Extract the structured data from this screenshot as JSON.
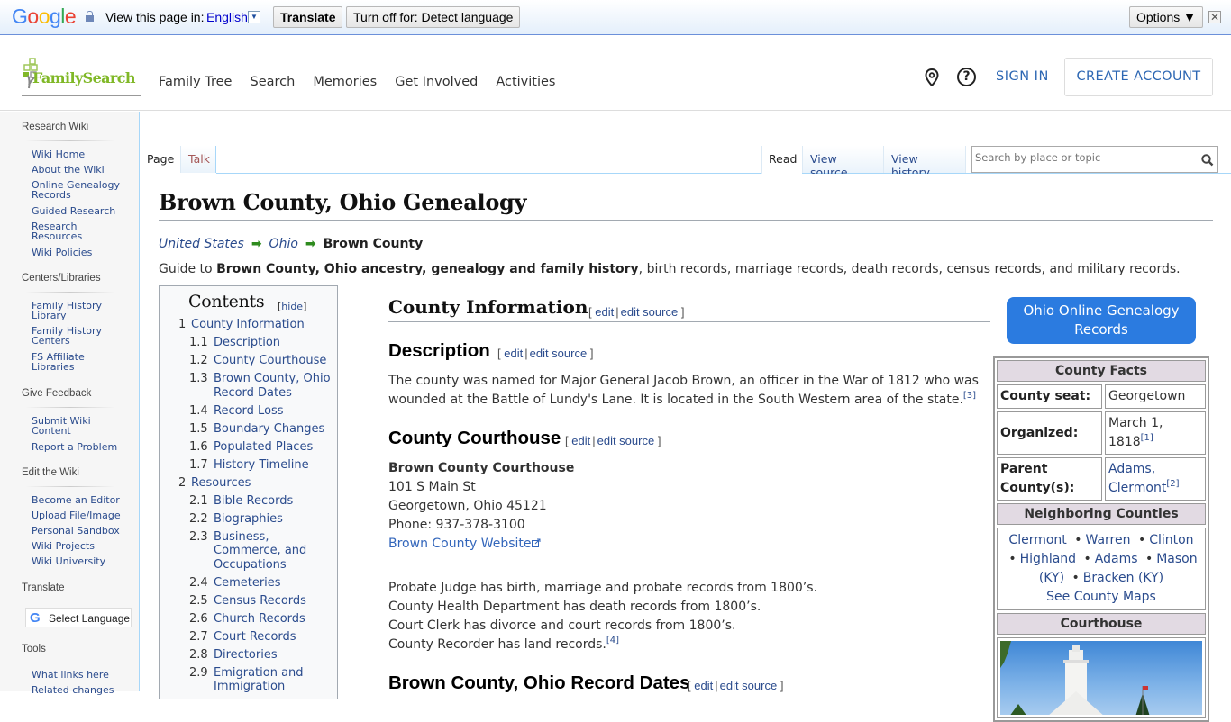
{
  "translate_bar": {
    "logo_letters": [
      "G",
      "o",
      "o",
      "g",
      "l",
      "e"
    ],
    "prompt": "View this page in:",
    "language": "English",
    "language_arrow": "▼",
    "translate_button": "Translate",
    "turn_off_button": "Turn off for: Detect language",
    "options_button": "Options ▼",
    "close_glyph": "✕"
  },
  "header": {
    "logo_text": "FamilySearch",
    "nav": [
      "Family Tree",
      "Search",
      "Memories",
      "Get Involved",
      "Activities"
    ],
    "help_glyph": "?",
    "sign_in": "SIGN IN",
    "create_account": "CREATE ACCOUNT"
  },
  "sidebar": {
    "sections": [
      {
        "title": "Research Wiki",
        "items": [
          "Wiki Home",
          "About the Wiki",
          "Online Genealogy Records",
          "Guided Research",
          "Research Resources",
          "Wiki Policies"
        ]
      },
      {
        "title": "Centers/Libraries",
        "items": [
          "Family History Library",
          "Family History Centers",
          "FS Affiliate Libraries"
        ]
      },
      {
        "title": "Give Feedback",
        "items": [
          "Submit Wiki Content",
          "Report a Problem"
        ]
      },
      {
        "title": "Edit the Wiki",
        "items": [
          "Become an Editor",
          "Upload File/Image",
          "Personal Sandbox",
          "Wiki Projects",
          "Wiki University"
        ]
      },
      {
        "title": "Translate",
        "items": []
      },
      {
        "title": "Tools",
        "items": [
          "What links here",
          "Related changes"
        ]
      }
    ],
    "select_language": "Select Language"
  },
  "tabs": {
    "page": "Page",
    "talk": "Talk",
    "read": "Read",
    "view_source": "View source",
    "view_history": "View history"
  },
  "search": {
    "placeholder": "Search by place or topic"
  },
  "article": {
    "title": "Brown County, Ohio Genealogy",
    "breadcrumb": [
      "United States",
      "Ohio"
    ],
    "breadcrumb_current": "Brown County",
    "breadcrumb_arrow": "➡",
    "intro_prefix": "Guide to ",
    "intro_bold": "Brown County, Ohio ancestry, genealogy and family history",
    "intro_suffix": ", birth records, marriage records, death records, census records, and military records.",
    "edit_links": {
      "open": "[",
      "edit": "edit",
      "sep": "|",
      "edit_source": "edit source",
      "close": "]"
    },
    "county_info_heading": "County Information",
    "description_heading": "Description",
    "description_text": "The county was named for Major General Jacob Brown, an officer in the War of 1812 who was wounded at the Battle of Lundy's Lane. It is located in the South Western area of the state.",
    "description_ref": "[3]",
    "courthouse_heading": "County Courthouse",
    "courthouse_name": "Brown County Courthouse",
    "courthouse_address1": "101 S Main St",
    "courthouse_address2": "Georgetown, Ohio 45121",
    "courthouse_phone": "Phone: 937-378-3100",
    "courthouse_website": "Brown County Website",
    "records_lines": [
      "Probate Judge has birth, marriage and probate records from 1800’s.",
      "County Health Department has death records from 1800’s.",
      "Court Clerk has divorce and court records from 1800’s.",
      "County Recorder has land records."
    ],
    "records_ref": "[4]",
    "record_dates_heading": "Brown County, Ohio Record Dates"
  },
  "toc": {
    "title": "Contents",
    "hide_label": "hide",
    "items": [
      {
        "num": "1",
        "label": "County Information",
        "level": 1
      },
      {
        "num": "1.1",
        "label": "Description",
        "level": 2
      },
      {
        "num": "1.2",
        "label": "County Courthouse",
        "level": 2
      },
      {
        "num": "1.3",
        "label": "Brown County, Ohio Record Dates",
        "level": 2
      },
      {
        "num": "1.4",
        "label": "Record Loss",
        "level": 2
      },
      {
        "num": "1.5",
        "label": "Boundary Changes",
        "level": 2
      },
      {
        "num": "1.6",
        "label": "Populated Places",
        "level": 2
      },
      {
        "num": "1.7",
        "label": "History Timeline",
        "level": 2
      },
      {
        "num": "2",
        "label": "Resources",
        "level": 1
      },
      {
        "num": "2.1",
        "label": "Bible Records",
        "level": 2
      },
      {
        "num": "2.2",
        "label": "Biographies",
        "level": 2
      },
      {
        "num": "2.3",
        "label": "Business, Commerce, and Occupations",
        "level": 2
      },
      {
        "num": "2.4",
        "label": "Cemeteries",
        "level": 2
      },
      {
        "num": "2.5",
        "label": "Census Records",
        "level": 2
      },
      {
        "num": "2.6",
        "label": "Church Records",
        "level": 2
      },
      {
        "num": "2.7",
        "label": "Court Records",
        "level": 2
      },
      {
        "num": "2.8",
        "label": "Directories",
        "level": 2
      },
      {
        "num": "2.9",
        "label": "Emigration and Immigration",
        "level": 2
      }
    ]
  },
  "infobox": {
    "ohio_button": "Ohio Online Genealogy Records",
    "facts_heading": "County Facts",
    "county_seat_label": "County seat:",
    "county_seat": "Georgetown",
    "organized_label": "Organized:",
    "organized": "March 1, 1818",
    "organized_ref": "[1]",
    "parent_label": "Parent County(s):",
    "parents": [
      "Adams,",
      "Clermont"
    ],
    "parent_ref": "[2]",
    "neighbors_heading": "Neighboring Counties",
    "neighbors": [
      "Clermont",
      "Warren",
      "Clinton",
      "Highland",
      "Adams",
      "Mason (KY)",
      "Bracken (KY)"
    ],
    "bullet": "•",
    "see_maps": "See County Maps",
    "courthouse_heading": "Courthouse"
  },
  "colors": {
    "link": "#2a4b8d",
    "fs_green": "#80b827",
    "fs_blue": "#2d67b3",
    "button_blue": "#2b7be0",
    "infobox_header": "#e2dae3",
    "breadcrumb_arrow": "#2e8b1e"
  }
}
